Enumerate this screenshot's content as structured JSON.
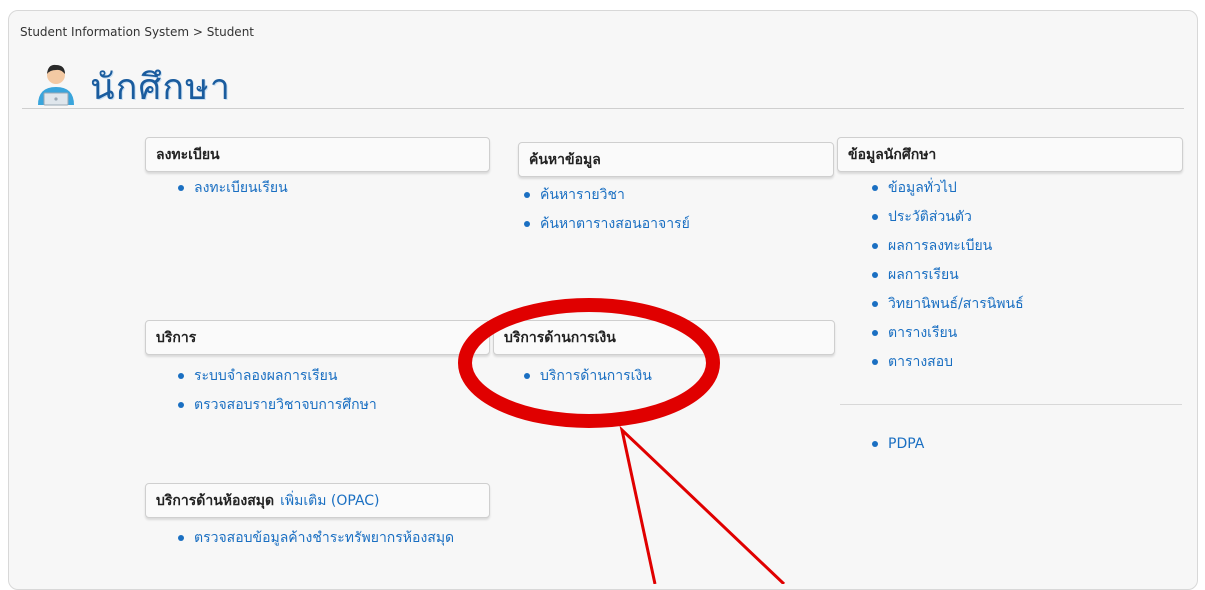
{
  "breadcrumb": "Student Information System > Student",
  "page_title": "นักศึกษา",
  "sections": {
    "register": {
      "title": "ลงทะเบียน",
      "items": [
        "ลงทะเบียนเรียน"
      ]
    },
    "search": {
      "title": "ค้นหาข้อมูล",
      "items": [
        "ค้นหารายวิชา",
        "ค้นหาตารางสอนอาจารย์"
      ]
    },
    "student_info": {
      "title": "ข้อมูลนักศึกษา",
      "items": [
        "ข้อมูลทั่วไป",
        "ประวัติส่วนตัว",
        "ผลการลงทะเบียน",
        "ผลการเรียน",
        "วิทยานิพนธ์/สารนิพนธ์",
        "ตารางเรียน",
        "ตารางสอบ"
      ],
      "extra_item": "PDPA"
    },
    "services": {
      "title": "บริการ",
      "items": [
        "ระบบจำลองผลการเรียน",
        "ตรวจสอบรายวิชาจบการศึกษา"
      ]
    },
    "finance": {
      "title": "บริการด้านการเงิน",
      "items": [
        "บริการด้านการเงิน"
      ]
    },
    "library": {
      "title": "บริการด้านห้องสมุด",
      "more_link": "เพิ่มเติม (OPAC)",
      "items": [
        "ตรวจสอบข้อมูลค้างชำระทรัพยากรห้องสมุด"
      ]
    }
  },
  "colors": {
    "link": "#1a6fc2",
    "title": "#1a5c9e",
    "annotation": "#e00000"
  }
}
